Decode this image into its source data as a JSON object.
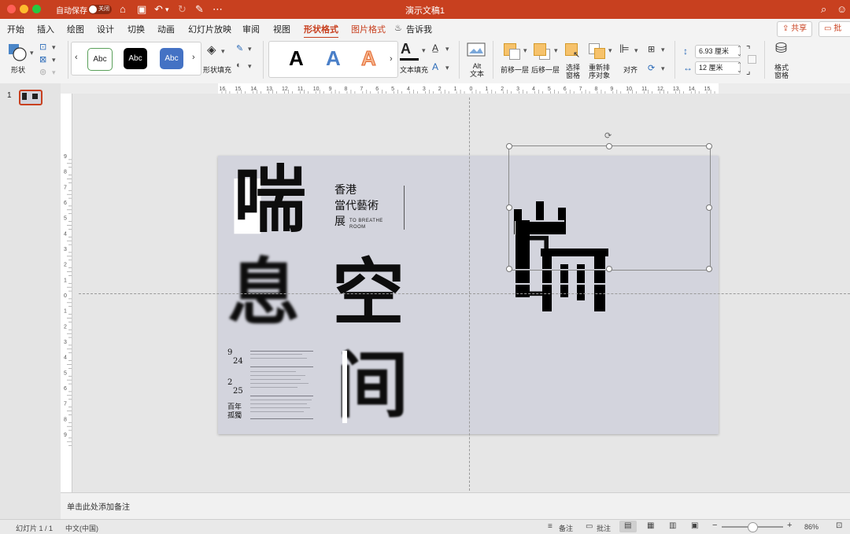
{
  "window": {
    "title": "演示文稿1",
    "autosave_label": "自动保存",
    "autosave_state": "关闭"
  },
  "colors": {
    "accent": "#c8401f",
    "slide_bg": "#d3d4dd"
  },
  "menu": {
    "tabs": [
      "开始",
      "插入",
      "绘图",
      "设计",
      "切换",
      "动画",
      "幻灯片放映",
      "审阅",
      "视图",
      "形状格式",
      "图片格式"
    ],
    "active_tab": "形状格式",
    "tell_me": "告诉我",
    "share": "共享",
    "comments": "批注"
  },
  "ribbon": {
    "shape_label": "形状",
    "style_abc": [
      "Abc",
      "Abc",
      "Abc"
    ],
    "fill_label": "形状填充",
    "wordart": [
      "A",
      "A",
      "A"
    ],
    "text_fill_label": "文本填充",
    "alt_text_label": "Alt\n文本",
    "bring_forward": "前移一层",
    "send_backward": "后移一层",
    "selection_pane": "选择\n窗格",
    "reorder": "重新排\n序对象",
    "align": "对齐",
    "height_value": "6.93 厘米",
    "width_value": "12 厘米",
    "format_pane": "格式\n窗格"
  },
  "ruler": {
    "h_labels": [
      "16",
      "15",
      "14",
      "13",
      "12",
      "11",
      "10",
      "9",
      "8",
      "7",
      "6",
      "5",
      "4",
      "3",
      "2",
      "1",
      "0",
      "1",
      "2",
      "3",
      "4",
      "5",
      "6",
      "7",
      "8",
      "9",
      "10",
      "11",
      "12",
      "13",
      "14",
      "15",
      "16"
    ],
    "v_labels": [
      "9",
      "8",
      "7",
      "6",
      "5",
      "4",
      "3",
      "2",
      "1",
      "0",
      "1",
      "2",
      "3",
      "4",
      "5",
      "6",
      "7",
      "8",
      "9"
    ]
  },
  "thumbnail": {
    "number": "1"
  },
  "slide": {
    "big_chars": [
      "喘",
      "息",
      "空",
      "间"
    ],
    "heading_lines": [
      "香港",
      "當代藝術",
      "展"
    ],
    "english_lines": [
      "TO BREATHE",
      "ROOM"
    ],
    "date1_month": "9",
    "date1_day": "24",
    "date2_month": "2",
    "date2_day": "25",
    "tagline_lines": [
      "百年",
      "孤獨"
    ]
  },
  "notes_placeholder": "单击此处添加备注",
  "status": {
    "slide_indicator": "幻灯片 1 / 1",
    "language": "中文(中国)",
    "notes_button": "备注",
    "comments_button": "批注",
    "zoom": "86%",
    "zoom_level": 0.5
  }
}
